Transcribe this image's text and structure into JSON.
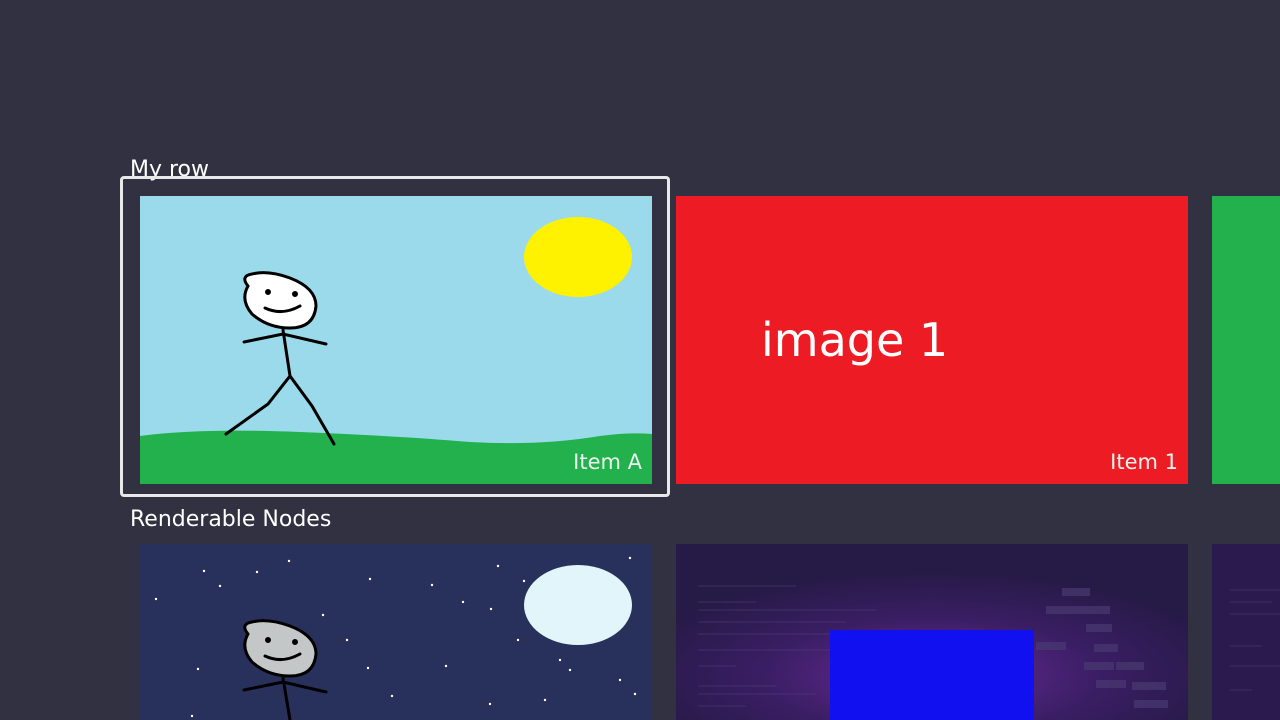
{
  "rows": [
    {
      "title": "My row",
      "items": [
        {
          "label": "Item A",
          "image": "stick-figure-day-scene",
          "colors": {
            "sky": "#9BDAEA",
            "grass": "#22B14C",
            "sun": "#FFF200"
          }
        },
        {
          "label": "Item 1",
          "image_text": "image 1",
          "colors": {
            "background": "#ED1C24"
          }
        },
        {
          "label": "",
          "colors": {
            "background": "#22B14C"
          }
        }
      ]
    },
    {
      "title": "Renderable Nodes",
      "items": [
        {
          "image": "stick-figure-night-scene",
          "colors": {
            "sky": "#28315B",
            "moon": "#E2F5FB"
          }
        },
        {
          "image": "code-screen-blue-square",
          "colors": {
            "background": "#2A1A4E",
            "square": "#1010F0"
          }
        },
        {
          "image": "code-screen-partial",
          "colors": {
            "background": "#2A1A4E"
          }
        }
      ]
    }
  ],
  "focus": {
    "row": 0,
    "item": 0
  }
}
